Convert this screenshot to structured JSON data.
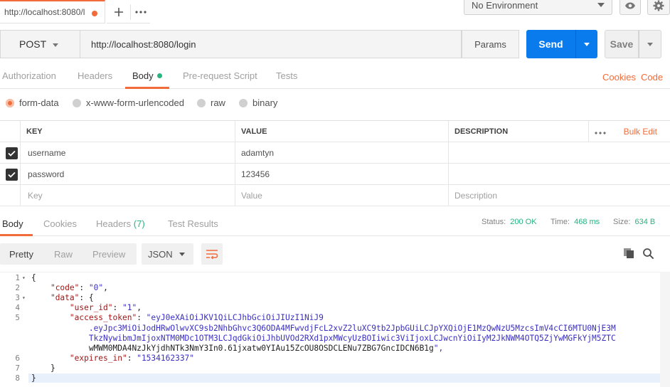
{
  "top_tab": {
    "title": "http://localhost:8080/l"
  },
  "environment": {
    "selected": "No Environment"
  },
  "request": {
    "method": "POST",
    "url": "http://localhost:8080/login",
    "params_label": "Params",
    "send_label": "Send",
    "save_label": "Save"
  },
  "request_tabs": {
    "authorization": "Authorization",
    "headers": "Headers",
    "body": "Body",
    "prerequest": "Pre-request Script",
    "tests": "Tests",
    "cookies": "Cookies",
    "code": "Code"
  },
  "body_modes": {
    "form_data": "form-data",
    "urlencoded": "x-www-form-urlencoded",
    "raw": "raw",
    "binary": "binary"
  },
  "kv_table": {
    "headers": {
      "key": "KEY",
      "value": "VALUE",
      "description": "DESCRIPTION",
      "bulk_edit": "Bulk Edit"
    },
    "rows": [
      {
        "key": "username",
        "value": "adamtyn",
        "description": ""
      },
      {
        "key": "password",
        "value": "123456",
        "description": ""
      }
    ],
    "placeholders": {
      "key": "Key",
      "value": "Value",
      "description": "Description"
    }
  },
  "response_tabs": {
    "body": "Body",
    "cookies": "Cookies",
    "headers": "Headers",
    "headers_count": "(7)",
    "test_results": "Test Results"
  },
  "status": {
    "status_label": "Status:",
    "status_value": "200 OK",
    "time_label": "Time:",
    "time_value": "468 ms",
    "size_label": "Size:",
    "size_value": "634 B"
  },
  "view_modes": {
    "pretty": "Pretty",
    "raw": "Raw",
    "preview": "Preview",
    "format": "JSON"
  },
  "code_lines": [
    {
      "n": "1",
      "fold": true,
      "text": "{"
    },
    {
      "n": "2",
      "fold": false,
      "text": "    \"code\": \"0\","
    },
    {
      "n": "3",
      "fold": true,
      "text": "    \"data\": {"
    },
    {
      "n": "4",
      "fold": false,
      "text": "        \"user_id\": \"1\","
    },
    {
      "n": "5",
      "fold": false,
      "text": "        \"access_token\": \"eyJ0eXAiOiJKV1QiLCJhbGciOiJIUzI1NiJ9"
    },
    {
      "n": "",
      "fold": false,
      "text": "            .eyJpc3MiOiJodHRwOlwvXC9sb2NhbGhvc3Q6ODA4MFwvdjFcL2xvZ2luXC9tb2JpbGUiLCJpYXQiOjE1MzQwNzU5MzcsImV4cCI6MTU0NjE3M"
    },
    {
      "n": "",
      "fold": false,
      "text": "            TkzNywibmJmIjoxNTM0MDc1OTM3LCJqdGkiOiJhbUVOd2RXd1pxMWcyUzBOIiwic3ViIjoxLCJwcnYiOiIyM2JkNWM4OTQ5ZjYwMGFkYjM5ZTC"
    },
    {
      "n": "",
      "fold": false,
      "text": "            wMWM0MDA4NzJkYjdhNTk3NmY3In0.61jxatw0YIAu15ZcOU8OSDCLENu7ZBG7GncIDCN6B1g\","
    },
    {
      "n": "6",
      "fold": false,
      "text": "        \"expires_in\": \"1534162337\""
    },
    {
      "n": "7",
      "fold": false,
      "text": "    }"
    },
    {
      "n": "8",
      "fold": false,
      "text": "}"
    }
  ],
  "colors": {
    "accent": "#f26b3a",
    "send": "#097bed",
    "success": "#26b47f"
  }
}
